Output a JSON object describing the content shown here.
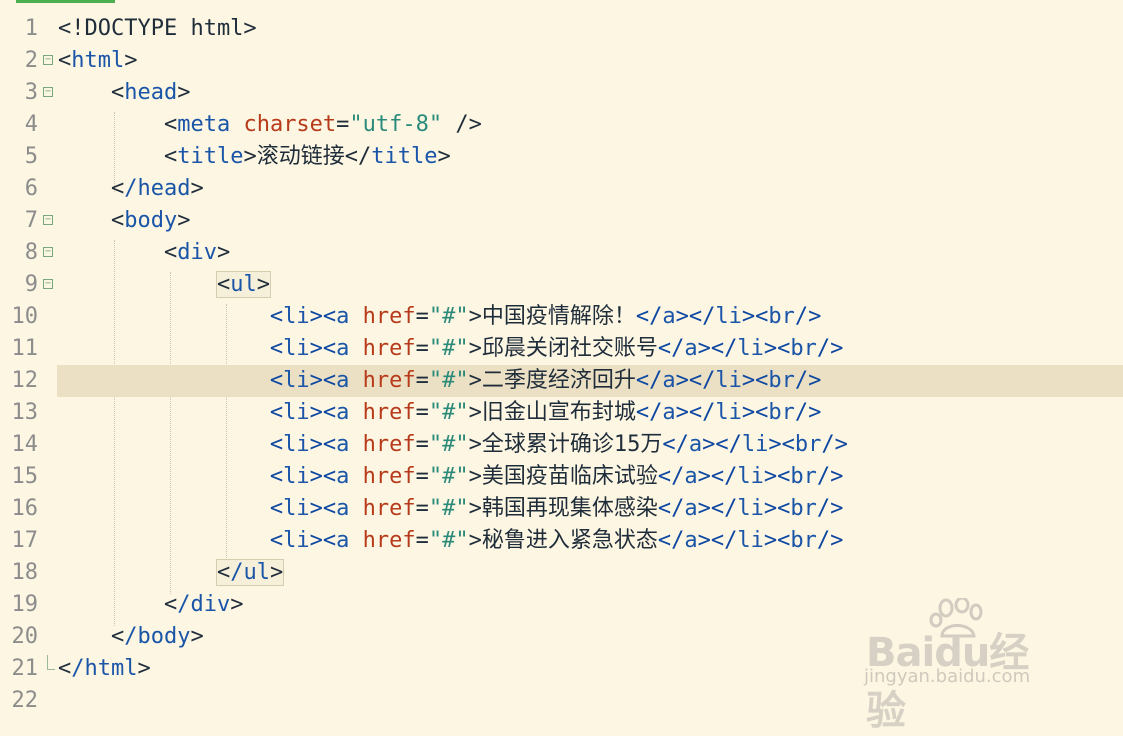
{
  "editor": {
    "lines": [
      {
        "num": "1",
        "doctype": "<!DOCTYPE html>"
      },
      {
        "num": "2",
        "tag": "html"
      },
      {
        "num": "3",
        "tag": "head"
      },
      {
        "num": "4",
        "tag": "meta",
        "attr": "charset",
        "value": "\"utf-8\"",
        "close": " />"
      },
      {
        "num": "5",
        "tag": "title",
        "text": "滚动链接",
        "closetag": "title"
      },
      {
        "num": "6",
        "tag": "/head"
      },
      {
        "num": "7",
        "tag": "body"
      },
      {
        "num": "8",
        "tag": "div"
      },
      {
        "num": "9",
        "tag": "ul"
      },
      {
        "num": "10",
        "text": "中国疫情解除！"
      },
      {
        "num": "11",
        "text": "邱晨关闭社交账号"
      },
      {
        "num": "12",
        "text": "二季度经济回升"
      },
      {
        "num": "13",
        "text": "旧金山宣布封城"
      },
      {
        "num": "14",
        "text": "全球累计确诊15万"
      },
      {
        "num": "15",
        "text": "美国疫苗临床试验"
      },
      {
        "num": "16",
        "text": "韩国再现集体感染"
      },
      {
        "num": "17",
        "text": "秘鲁进入紧急状态"
      },
      {
        "num": "18",
        "tag": "/ul"
      },
      {
        "num": "19",
        "tag": "/div"
      },
      {
        "num": "20",
        "tag": "/body"
      },
      {
        "num": "21",
        "tag": "/html"
      },
      {
        "num": "22"
      }
    ],
    "link_tokens": {
      "li_open": "<li>",
      "a_open": "<a",
      "href_attr": "href",
      "eq": "=",
      "href_val": "\"#\"",
      "gt": ">",
      "a_close": "</a>",
      "li_close": "</li>",
      "br": "<br/>"
    },
    "current_line": "12"
  },
  "watermark": {
    "brand": "Baidu经验",
    "url": "jingyan.baidu.com"
  },
  "colors": {
    "background": "#fdf6e3",
    "current_line": "#ebe0c4",
    "tag": "#1a55a8",
    "attribute": "#b73a1a",
    "string": "#2a8a7a"
  }
}
